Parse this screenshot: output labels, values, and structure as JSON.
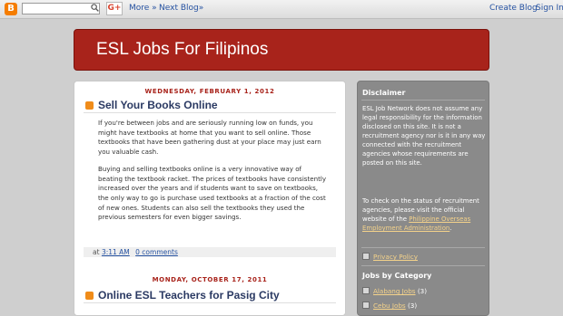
{
  "navbar": {
    "logo_glyph": "B",
    "search_value": "",
    "gplus_label": "G+",
    "more_label": "More »",
    "next_blog_label": "Next Blog»",
    "create_blog_label": "Create Blog",
    "sign_in_label": "Sign In"
  },
  "blog": {
    "title": "ESL Jobs For Filipinos"
  },
  "posts": [
    {
      "date": "WEDNESDAY, FEBRUARY 1, 2012",
      "title": "Sell Your Books Online",
      "paragraphs": [
        "If you're between jobs and are seriously running low on funds, you might have textbooks at home that you want to sell online.  Those textbooks that have been gathering dust at your place may just earn you valuable cash.",
        "Buying and selling textbooks online is a very innovative way of beating the textbook racket.  The prices of textbooks have consistently increased over the years and if students want to save on textbooks, the only way to go is purchase used textbooks at a fraction of the cost of new ones.  Students can also sell the textbooks they used the previous semesters for even bigger savings."
      ],
      "footer_at": "at",
      "time": "3:11 AM",
      "comments": "0 comments"
    },
    {
      "date": "MONDAY, OCTOBER 17, 2011",
      "title": "Online ESL Teachers for Pasig City"
    }
  ],
  "sidebar": {
    "disclaimer_heading": "Disclaimer",
    "disclaimer_p1": "ESL Job Network does not assume any legal responsibility for the information disclosed on this site. It is not a recruitment agency nor is it in any way connected with the recruitment agencies whose requirements are posted on this site.",
    "disclaimer_p2_start": "To check on the status of recruitment agencies, please visit the official website of the ",
    "disclaimer_p2_link": "Philippine Overseas Employment Administration",
    "disclaimer_p2_end": ".",
    "privacy_label": "Privacy Policy",
    "jobs_heading": "Jobs by Category",
    "categories": [
      {
        "name": "Alabang Jobs",
        "count": "(3)"
      },
      {
        "name": "Cebu Jobs",
        "count": "(3)"
      }
    ]
  }
}
